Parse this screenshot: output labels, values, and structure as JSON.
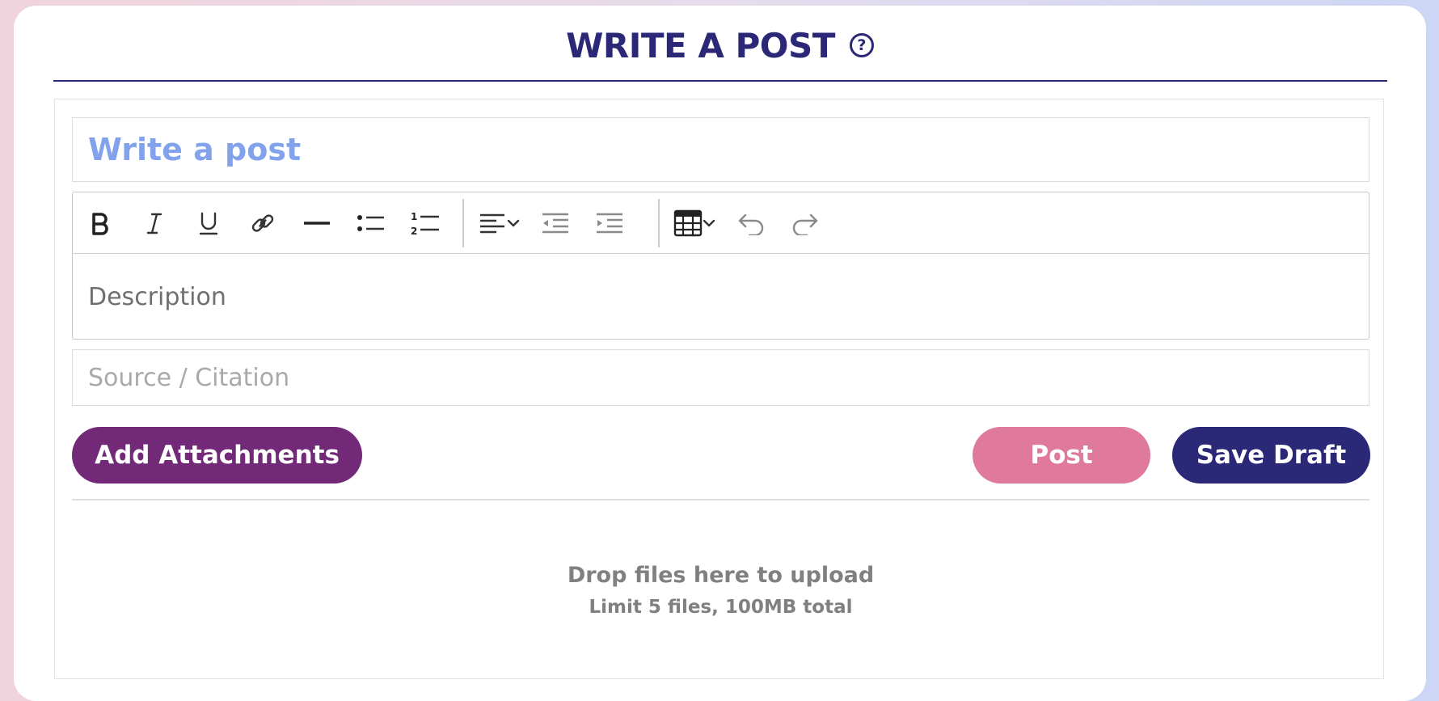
{
  "header": {
    "title": "WRITE A POST",
    "help_icon": "question-circle-icon"
  },
  "form": {
    "title_placeholder": "Write a post",
    "description_placeholder": "Description",
    "source_placeholder": "Source / Citation"
  },
  "toolbar": {
    "buttons": [
      "bold-icon",
      "italic-icon",
      "underline-icon",
      "link-icon",
      "horizontal-rule-icon",
      "bullet-list-icon",
      "numbered-list-icon",
      "align-left-icon",
      "chevron-down-icon",
      "outdent-icon",
      "indent-icon",
      "table-icon",
      "chevron-down-icon",
      "undo-icon",
      "redo-icon"
    ]
  },
  "actions": {
    "attach_label": "Add Attachments",
    "post_label": "Post",
    "draft_label": "Save Draft"
  },
  "dropzone": {
    "main_text": "Drop files here to upload",
    "limit_text": "Limit 5 files, 100MB total"
  },
  "colors": {
    "brand_navy": "#2b2878",
    "purple": "#722a78",
    "pink": "#df7a9c",
    "title_placeholder": "#82a3ec"
  }
}
